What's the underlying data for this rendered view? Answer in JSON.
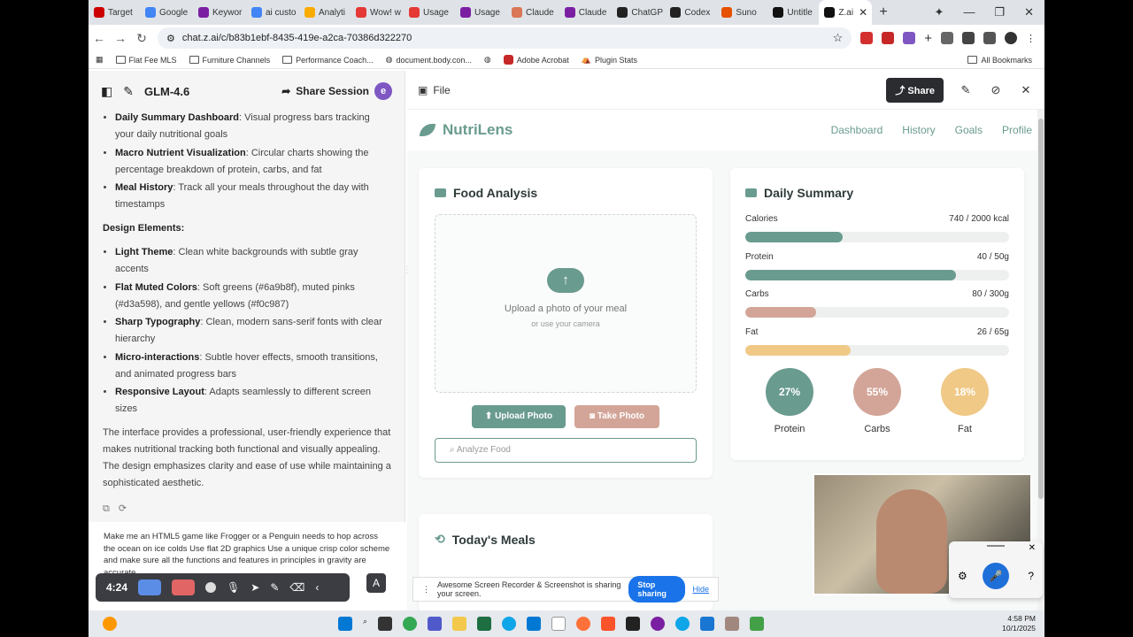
{
  "browser": {
    "tabs": [
      {
        "label": "Target",
        "color": "#cc0000"
      },
      {
        "label": "Google",
        "color": "#4285f4"
      },
      {
        "label": "Keywor",
        "color": "#7b1fa2"
      },
      {
        "label": "ai custo",
        "color": "#4285f4"
      },
      {
        "label": "Analyti",
        "color": "#f9ab00"
      },
      {
        "label": "Wow! w",
        "color": "#e53935"
      },
      {
        "label": "Usage",
        "color": "#e53935"
      },
      {
        "label": "Usage",
        "color": "#7b1fa2"
      },
      {
        "label": "Claude",
        "color": "#d97757"
      },
      {
        "label": "Claude",
        "color": "#7b1fa2"
      },
      {
        "label": "ChatGP",
        "color": "#222222"
      },
      {
        "label": "Codex",
        "color": "#222222"
      },
      {
        "label": "Suno",
        "color": "#e65100"
      },
      {
        "label": "Untitle",
        "color": "#111111"
      },
      {
        "label": "Z.ai",
        "color": "#111111"
      }
    ],
    "url": "chat.z.ai/c/b83b1ebf-8435-419e-a2ca-70386d322270",
    "bookmarks": [
      "Flat Fee MLS",
      "Furniture Channels",
      "Performance Coach...",
      "document.body.con...",
      "",
      "Adobe Acrobat",
      "Plugin Stats"
    ],
    "all_bookmarks": "All Bookmarks"
  },
  "chat": {
    "model": "GLM-4.6",
    "share_session": "Share Session",
    "avatar_letter": "e",
    "features": [
      {
        "bold": "Daily Summary Dashboard",
        "text": ": Visual progress bars tracking your daily nutritional goals"
      },
      {
        "bold": "Macro Nutrient Visualization",
        "text": ": Circular charts showing the percentage breakdown of protein, carbs, and fat"
      },
      {
        "bold": "Meal History",
        "text": ": Track all your meals throughout the day with timestamps"
      }
    ],
    "design_heading": "Design Elements:",
    "design": [
      {
        "bold": "Light Theme",
        "text": ": Clean white backgrounds with subtle gray accents"
      },
      {
        "bold": "Flat Muted Colors",
        "text": ": Soft greens (#6a9b8f), muted pinks (#d3a598), and gentle yellows (#f0c987)"
      },
      {
        "bold": "Sharp Typography",
        "text": ": Clean, modern sans-serif fonts with clear hierarchy"
      },
      {
        "bold": "Micro-interactions",
        "text": ": Subtle hover effects, smooth transitions, and animated progress bars"
      },
      {
        "bold": "Responsive Layout",
        "text": ": Adapts seamlessly to different screen sizes"
      }
    ],
    "summary": "The interface provides a professional, user-friendly experience that makes nutritional tracking both functional and visually appealing. The design emphasizes clarity and ease of use while maintaining a sophisticated aesthetic.",
    "prompt": "Make me an HTML5 game like Frogger or a Penguin needs to hop across the ocean on ice colds Use flat 2D graphics Use a unique crisp color scheme and make sure all the functions and features in principles in gravity are accurate"
  },
  "recorder": {
    "time": "4:24"
  },
  "preview": {
    "file_label": "File",
    "share": "Share"
  },
  "app": {
    "name": "NutriLens",
    "nav": [
      "Dashboard",
      "History",
      "Goals",
      "Profile"
    ],
    "food_analysis": {
      "title": "Food Analysis",
      "upload_main": "Upload a photo of your meal",
      "upload_sub": "or use your camera",
      "upload_btn": "Upload Photo",
      "take_btn": "Take Photo",
      "analyze_placeholder": "Analyze Food"
    },
    "daily_summary": {
      "title": "Daily Summary",
      "stats": [
        {
          "label": "Calories",
          "value": "740 / 2000 kcal",
          "fraction": 0.37,
          "color": "#6a9b8f"
        },
        {
          "label": "Protein",
          "value": "40 / 50g",
          "fraction": 0.8,
          "color": "#6a9b8f"
        },
        {
          "label": "Carbs",
          "value": "80 / 300g",
          "fraction": 0.27,
          "color": "#d3a598"
        },
        {
          "label": "Fat",
          "value": "26 / 65g",
          "fraction": 0.4,
          "color": "#f0c987"
        }
      ],
      "macros": [
        {
          "pct": "27%",
          "label": "Protein",
          "color": "#6a9b8f"
        },
        {
          "pct": "55%",
          "label": "Carbs",
          "color": "#d3a598"
        },
        {
          "pct": "18%",
          "label": "Fat",
          "color": "#f0c987"
        }
      ]
    },
    "todays_meals": {
      "title": "Today's Meals"
    }
  },
  "screen_share": {
    "message": "Awesome Screen Recorder & Screenshot is sharing your screen.",
    "stop": "Stop sharing",
    "hide": "Hide"
  },
  "taskbar": {
    "time": "4:58 PM",
    "date": "10/1/2025"
  }
}
